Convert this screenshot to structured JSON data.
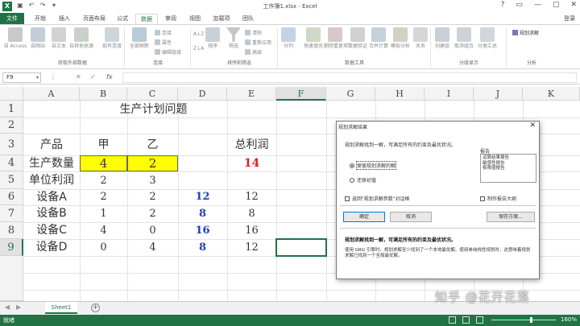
{
  "window": {
    "app_icon": "X",
    "title": "工作簿1.xlsx - Excel",
    "login": "登录",
    "controls": [
      "?",
      "▭",
      "—",
      "▢",
      "✕"
    ]
  },
  "tabs": [
    "文件",
    "开始",
    "插入",
    "页面布局",
    "公式",
    "数据",
    "审阅",
    "视图",
    "加载项",
    "团队"
  ],
  "active_tab": "数据",
  "ribbon": {
    "groups": [
      "获取外部数据",
      "连接",
      "排序和筛选",
      "数据工具",
      "分级显示",
      "分析"
    ],
    "buttons": {
      "access": "自 Access",
      "web": "自网站",
      "text": "自文本",
      "other": "自其他来源",
      "existing": "现有连接",
      "refresh": "全部刷新",
      "connections": "连接",
      "properties": "属性",
      "edit_links": "编辑链接",
      "sort_az": "A↓Z",
      "sort_za": "Z↓A",
      "sort": "排序",
      "filter": "筛选",
      "clear": "清除",
      "reapply": "重新应用",
      "advanced": "高级",
      "split": "分列",
      "flash_fill": "快速填充",
      "remove_dup": "删除重复项",
      "validation": "数据验证",
      "consolidate": "合并计算",
      "whatif": "模拟分析",
      "relationships": "关系",
      "group": "创建组",
      "ungroup": "取消组合",
      "subtotal": "分类汇总",
      "solver": "规划求解"
    }
  },
  "formula_bar": {
    "name_box": "F9",
    "cancel": "✕",
    "enter": "✓",
    "fx": "fx",
    "value": ""
  },
  "grid": {
    "columns": [
      "A",
      "B",
      "C",
      "D",
      "E",
      "F",
      "G",
      "H",
      "I",
      "J",
      "K"
    ],
    "rows": [
      "1",
      "2",
      "3",
      "4",
      "5",
      "6",
      "7",
      "8",
      "9"
    ],
    "cells": {
      "title": "生产计划问题",
      "a3": "产品",
      "b3": "甲",
      "c3": "乙",
      "e3": "总利润",
      "a4": "生产数量",
      "b4": "4",
      "c4": "2",
      "e4": "14",
      "a5": "单位利润",
      "b5": "2",
      "c5": "3",
      "a6": "设备A",
      "b6": "2",
      "c6": "2",
      "d6": "12",
      "e6": "12",
      "a7": "设备B",
      "b7": "1",
      "c7": "2",
      "d7": "8",
      "e7": "8",
      "a8": "设备C",
      "b8": "4",
      "c8": "0",
      "d8": "16",
      "e8": "16",
      "a9": "设备D",
      "b9": "0",
      "c9": "4",
      "d9": "8",
      "e9": "12"
    }
  },
  "sheets": {
    "tab": "Sheet1",
    "add": "+"
  },
  "status": {
    "ready": "就绪",
    "zoom": "160%"
  },
  "dialog": {
    "title": "规划求解结果",
    "close": "✕",
    "message": "规划求解找到一解，可满足所有的约束及最优状况。",
    "reports_title": "报告",
    "reports": [
      "运算结果报告",
      "敏感性报告",
      "极限值报告"
    ],
    "radio_keep": "保留规划求解的解",
    "radio_restore": "还原初值",
    "check_return": "返回\"规划求解参数\"对话框",
    "check_outline": "制作报告大纲",
    "ok": "确定",
    "cancel": "取消",
    "save": "保存方案...",
    "bold_text": "规划求解找到一解，可满足所有的约束及最优状况。",
    "desc": "使用 GRG 引擎时，规划求解至少找到了一个本地最优解。使用单纯线性规划时，这意味着规划求解已找到一个全局最优解。"
  },
  "watermark": "知乎 @花开花落",
  "colors": {
    "excel_green": "#217346",
    "yellow": "#ffff00",
    "blue": "#1f3fbf",
    "red": "#e02020"
  }
}
